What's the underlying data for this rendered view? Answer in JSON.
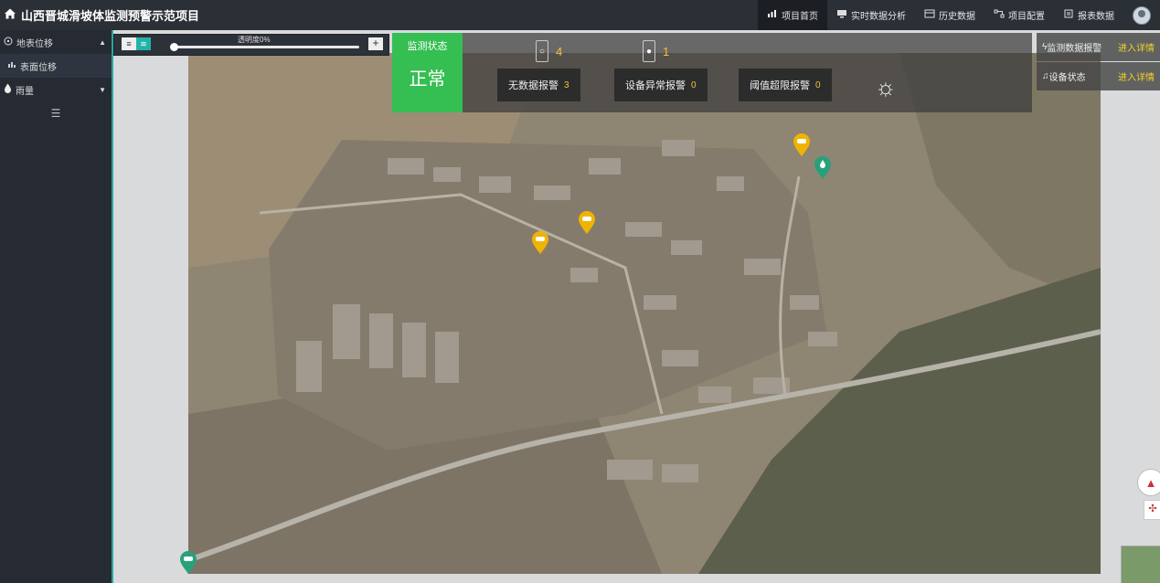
{
  "app": {
    "title": "山西晋城滑坡体监测预警示范项目"
  },
  "nav": [
    {
      "label": "项目首页",
      "icon": "chart-icon"
    },
    {
      "label": "实时数据分析",
      "icon": "monitor-icon"
    },
    {
      "label": "历史数据",
      "icon": "database-icon"
    },
    {
      "label": "项目配置",
      "icon": "config-icon"
    },
    {
      "label": "报表数据",
      "icon": "report-icon"
    }
  ],
  "sidebar": {
    "items": [
      {
        "label": "地表位移",
        "icon": "target-icon"
      },
      {
        "label": "表面位移",
        "icon": "bar-chart-icon"
      },
      {
        "label": "雨量",
        "icon": "raindrop-icon"
      }
    ]
  },
  "map": {
    "opacity_label": "透明度0%",
    "opacity_value": 0,
    "plus": "+"
  },
  "status": {
    "title": "监测状态",
    "value": "正常",
    "counts": [
      {
        "icon": "sensor-icon",
        "value": "4"
      },
      {
        "icon": "raindrop-icon",
        "value": "1"
      }
    ],
    "alarms": [
      {
        "label": "无数据报警",
        "value": "3"
      },
      {
        "label": "设备异常报警",
        "value": "0"
      },
      {
        "label": "阈值超限报警",
        "value": "0"
      }
    ]
  },
  "right_panel": {
    "rows": [
      {
        "label": "监测数据报警",
        "icon": "lightning-icon",
        "link": "进入详情"
      },
      {
        "label": "设备状态",
        "icon": "bell-icon",
        "link": "进入详情"
      }
    ]
  },
  "colors": {
    "accent": "#2aa7a0",
    "ok": "#35be52",
    "pin_yellow": "#f0b400",
    "pin_green": "#27a17a"
  }
}
